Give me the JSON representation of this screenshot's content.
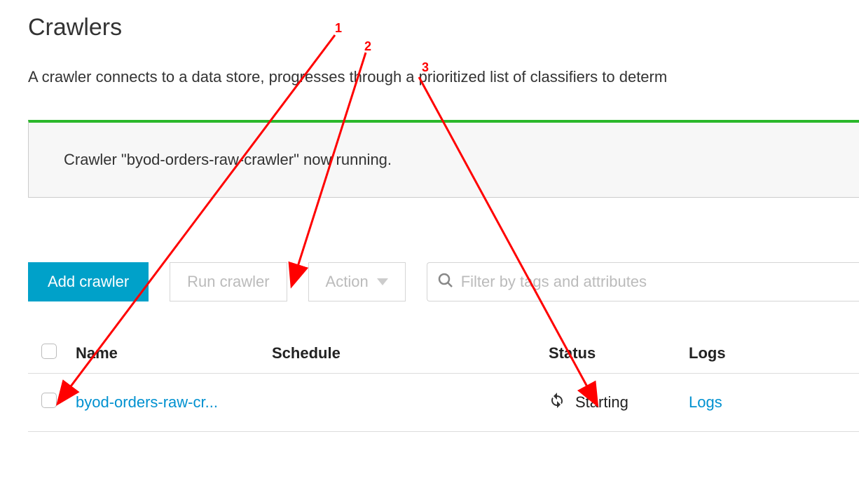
{
  "page": {
    "title": "Crawlers",
    "description": "A crawler connects to a data store, progresses through a prioritized list of classifiers to determ"
  },
  "notice": {
    "prefix": "Crawler ",
    "name": "\"byod-orders-raw-crawler\"",
    "suffix": " now running."
  },
  "toolbar": {
    "add_label": "Add crawler",
    "run_label": "Run crawler",
    "action_label": "Action",
    "search_placeholder": "Filter by tags and attributes"
  },
  "table": {
    "headers": {
      "name": "Name",
      "schedule": "Schedule",
      "status": "Status",
      "logs": "Logs"
    },
    "rows": [
      {
        "name": "byod-orders-raw-cr...",
        "schedule": "",
        "status": "Starting",
        "logs": "Logs"
      }
    ]
  },
  "annotations": {
    "n1": "1",
    "n2": "2",
    "n3": "3"
  }
}
